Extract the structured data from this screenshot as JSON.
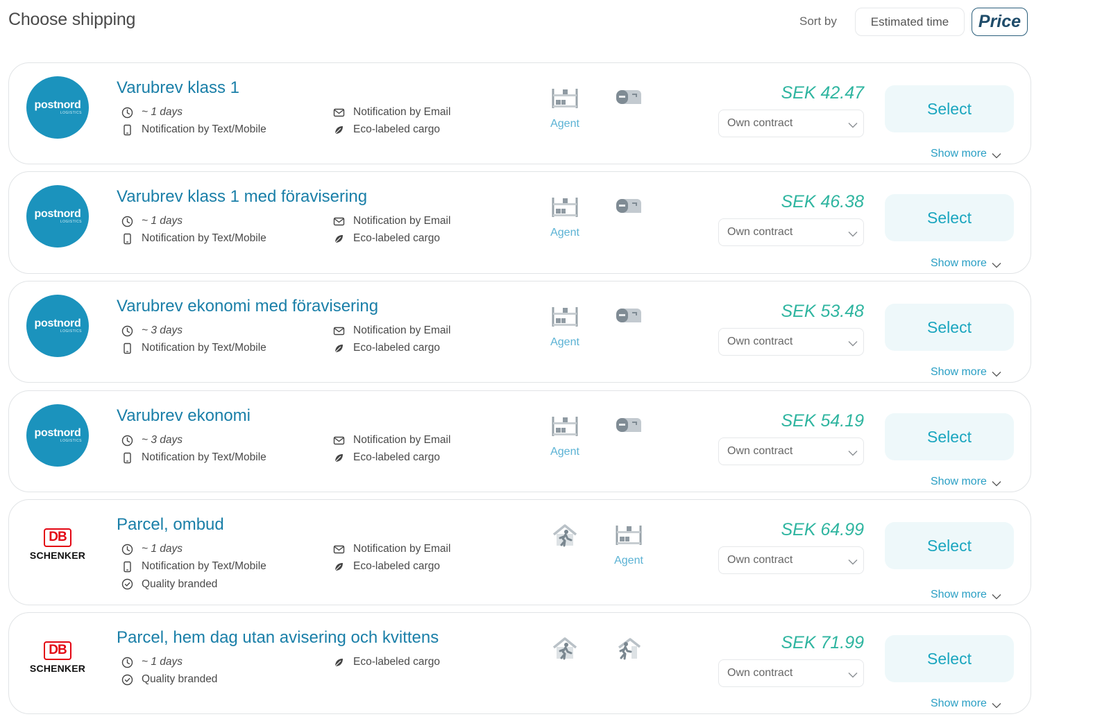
{
  "header": {
    "title": "Choose shipping",
    "sort_label": "Sort by",
    "sort_options": [
      {
        "label": "Estimated time",
        "active": false
      },
      {
        "label": "Price",
        "active": true
      }
    ]
  },
  "common": {
    "select_label": "Select",
    "show_more_label": "Show more",
    "contract_value": "Own contract",
    "agent_label": "Agent"
  },
  "colors": {
    "accent": "#1a7fa8",
    "price": "#2fb5a0",
    "select_bg": "#eef8fa",
    "postnord": "#1b93bd",
    "db_red": "#e30613"
  },
  "options": [
    {
      "carrier": "postnord",
      "carrier_logo_text": "postnord",
      "carrier_logo_sub": "LOGISTICS",
      "name": "Varubrev klass 1",
      "time": "~ 1 days",
      "features": [
        "Notification by Text/Mobile",
        "Notification by Email",
        "Eco-labeled cargo"
      ],
      "price": "SEK 42.47",
      "delivery_icons": [
        "agent-icon",
        "mailbox-icon"
      ]
    },
    {
      "carrier": "postnord",
      "carrier_logo_text": "postnord",
      "carrier_logo_sub": "LOGISTICS",
      "name": "Varubrev klass 1 med föravisering",
      "time": "~ 1 days",
      "features": [
        "Notification by Text/Mobile",
        "Notification by Email",
        "Eco-labeled cargo"
      ],
      "price": "SEK 46.38",
      "delivery_icons": [
        "agent-icon",
        "mailbox-icon"
      ]
    },
    {
      "carrier": "postnord",
      "carrier_logo_text": "postnord",
      "carrier_logo_sub": "LOGISTICS",
      "name": "Varubrev ekonomi med föravisering",
      "time": "~ 3 days",
      "features": [
        "Notification by Text/Mobile",
        "Notification by Email",
        "Eco-labeled cargo"
      ],
      "price": "SEK 53.48",
      "delivery_icons": [
        "agent-icon",
        "mailbox-icon"
      ]
    },
    {
      "carrier": "postnord",
      "carrier_logo_text": "postnord",
      "carrier_logo_sub": "LOGISTICS",
      "name": "Varubrev ekonomi",
      "time": "~ 3 days",
      "features": [
        "Notification by Text/Mobile",
        "Notification by Email",
        "Eco-labeled cargo"
      ],
      "price": "SEK 54.19",
      "delivery_icons": [
        "agent-icon",
        "mailbox-icon"
      ]
    },
    {
      "carrier": "dbschenker",
      "carrier_logo_text": "DB",
      "carrier_logo_sub": "SCHENKER",
      "name": "Parcel, ombud",
      "time": "~ 1 days",
      "features": [
        "Notification by Text/Mobile",
        "Quality branded",
        "Notification by Email",
        "Eco-labeled cargo"
      ],
      "price": "SEK 64.99",
      "delivery_icons": [
        "home-delivery-icon",
        "agent-icon"
      ]
    },
    {
      "carrier": "dbschenker",
      "carrier_logo_text": "DB",
      "carrier_logo_sub": "SCHENKER",
      "name": "Parcel, hem dag utan avisering och kvittens",
      "time": "~ 1 days",
      "features": [
        "Quality branded",
        "Eco-labeled cargo"
      ],
      "price": "SEK 71.99",
      "delivery_icons": [
        "home-delivery-icon",
        "door-delivery-icon"
      ]
    }
  ]
}
